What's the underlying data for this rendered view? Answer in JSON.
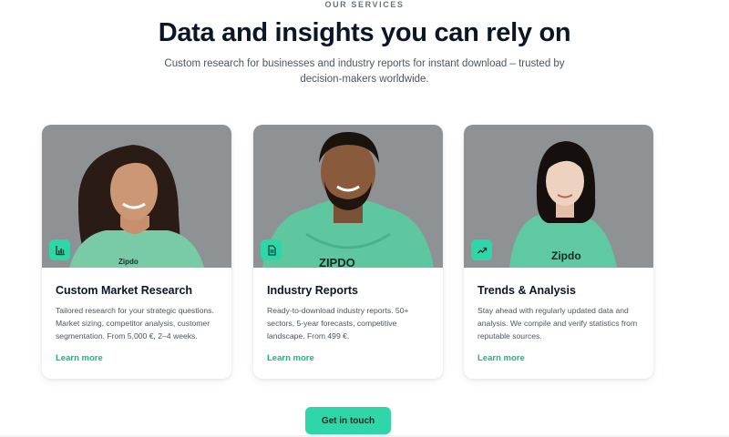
{
  "header": {
    "eyebrow": "OUR SERVICES",
    "title": "Data and insights you can rely on",
    "subtitle": "Custom research for businesses and industry reports for instant download – trusted by decision-makers worldwide."
  },
  "cards": [
    {
      "title": "Custom Market Research",
      "description": "Tailored research for your strategic questions. Market sizing, competitor analysis, customer segmentation. From 5,000 €, 2–4 weeks.",
      "link": "Learn more",
      "icon": "bar-chart-icon",
      "shirt_print": "Zipdo"
    },
    {
      "title": "Industry Reports",
      "description": "Ready-to-download industry reports. 50+ sectors, 5-year forecasts, competitive landscape. From 499 €.",
      "link": "Learn more",
      "icon": "document-icon",
      "shirt_print": "ZIPDO"
    },
    {
      "title": "Trends & Analysis",
      "description": "Stay ahead with regularly updated data and analysis. We compile and verify statistics from reputable sources.",
      "link": "Learn more",
      "icon": "trending-up-icon",
      "shirt_print": "Zipdo"
    }
  ],
  "cta": {
    "label": "Get in touch"
  },
  "colors": {
    "accent": "#2fd6a7",
    "link": "#14b88a",
    "heading": "#0b1626",
    "body_text": "#4b5563",
    "photo_bg": "#8f9294"
  }
}
